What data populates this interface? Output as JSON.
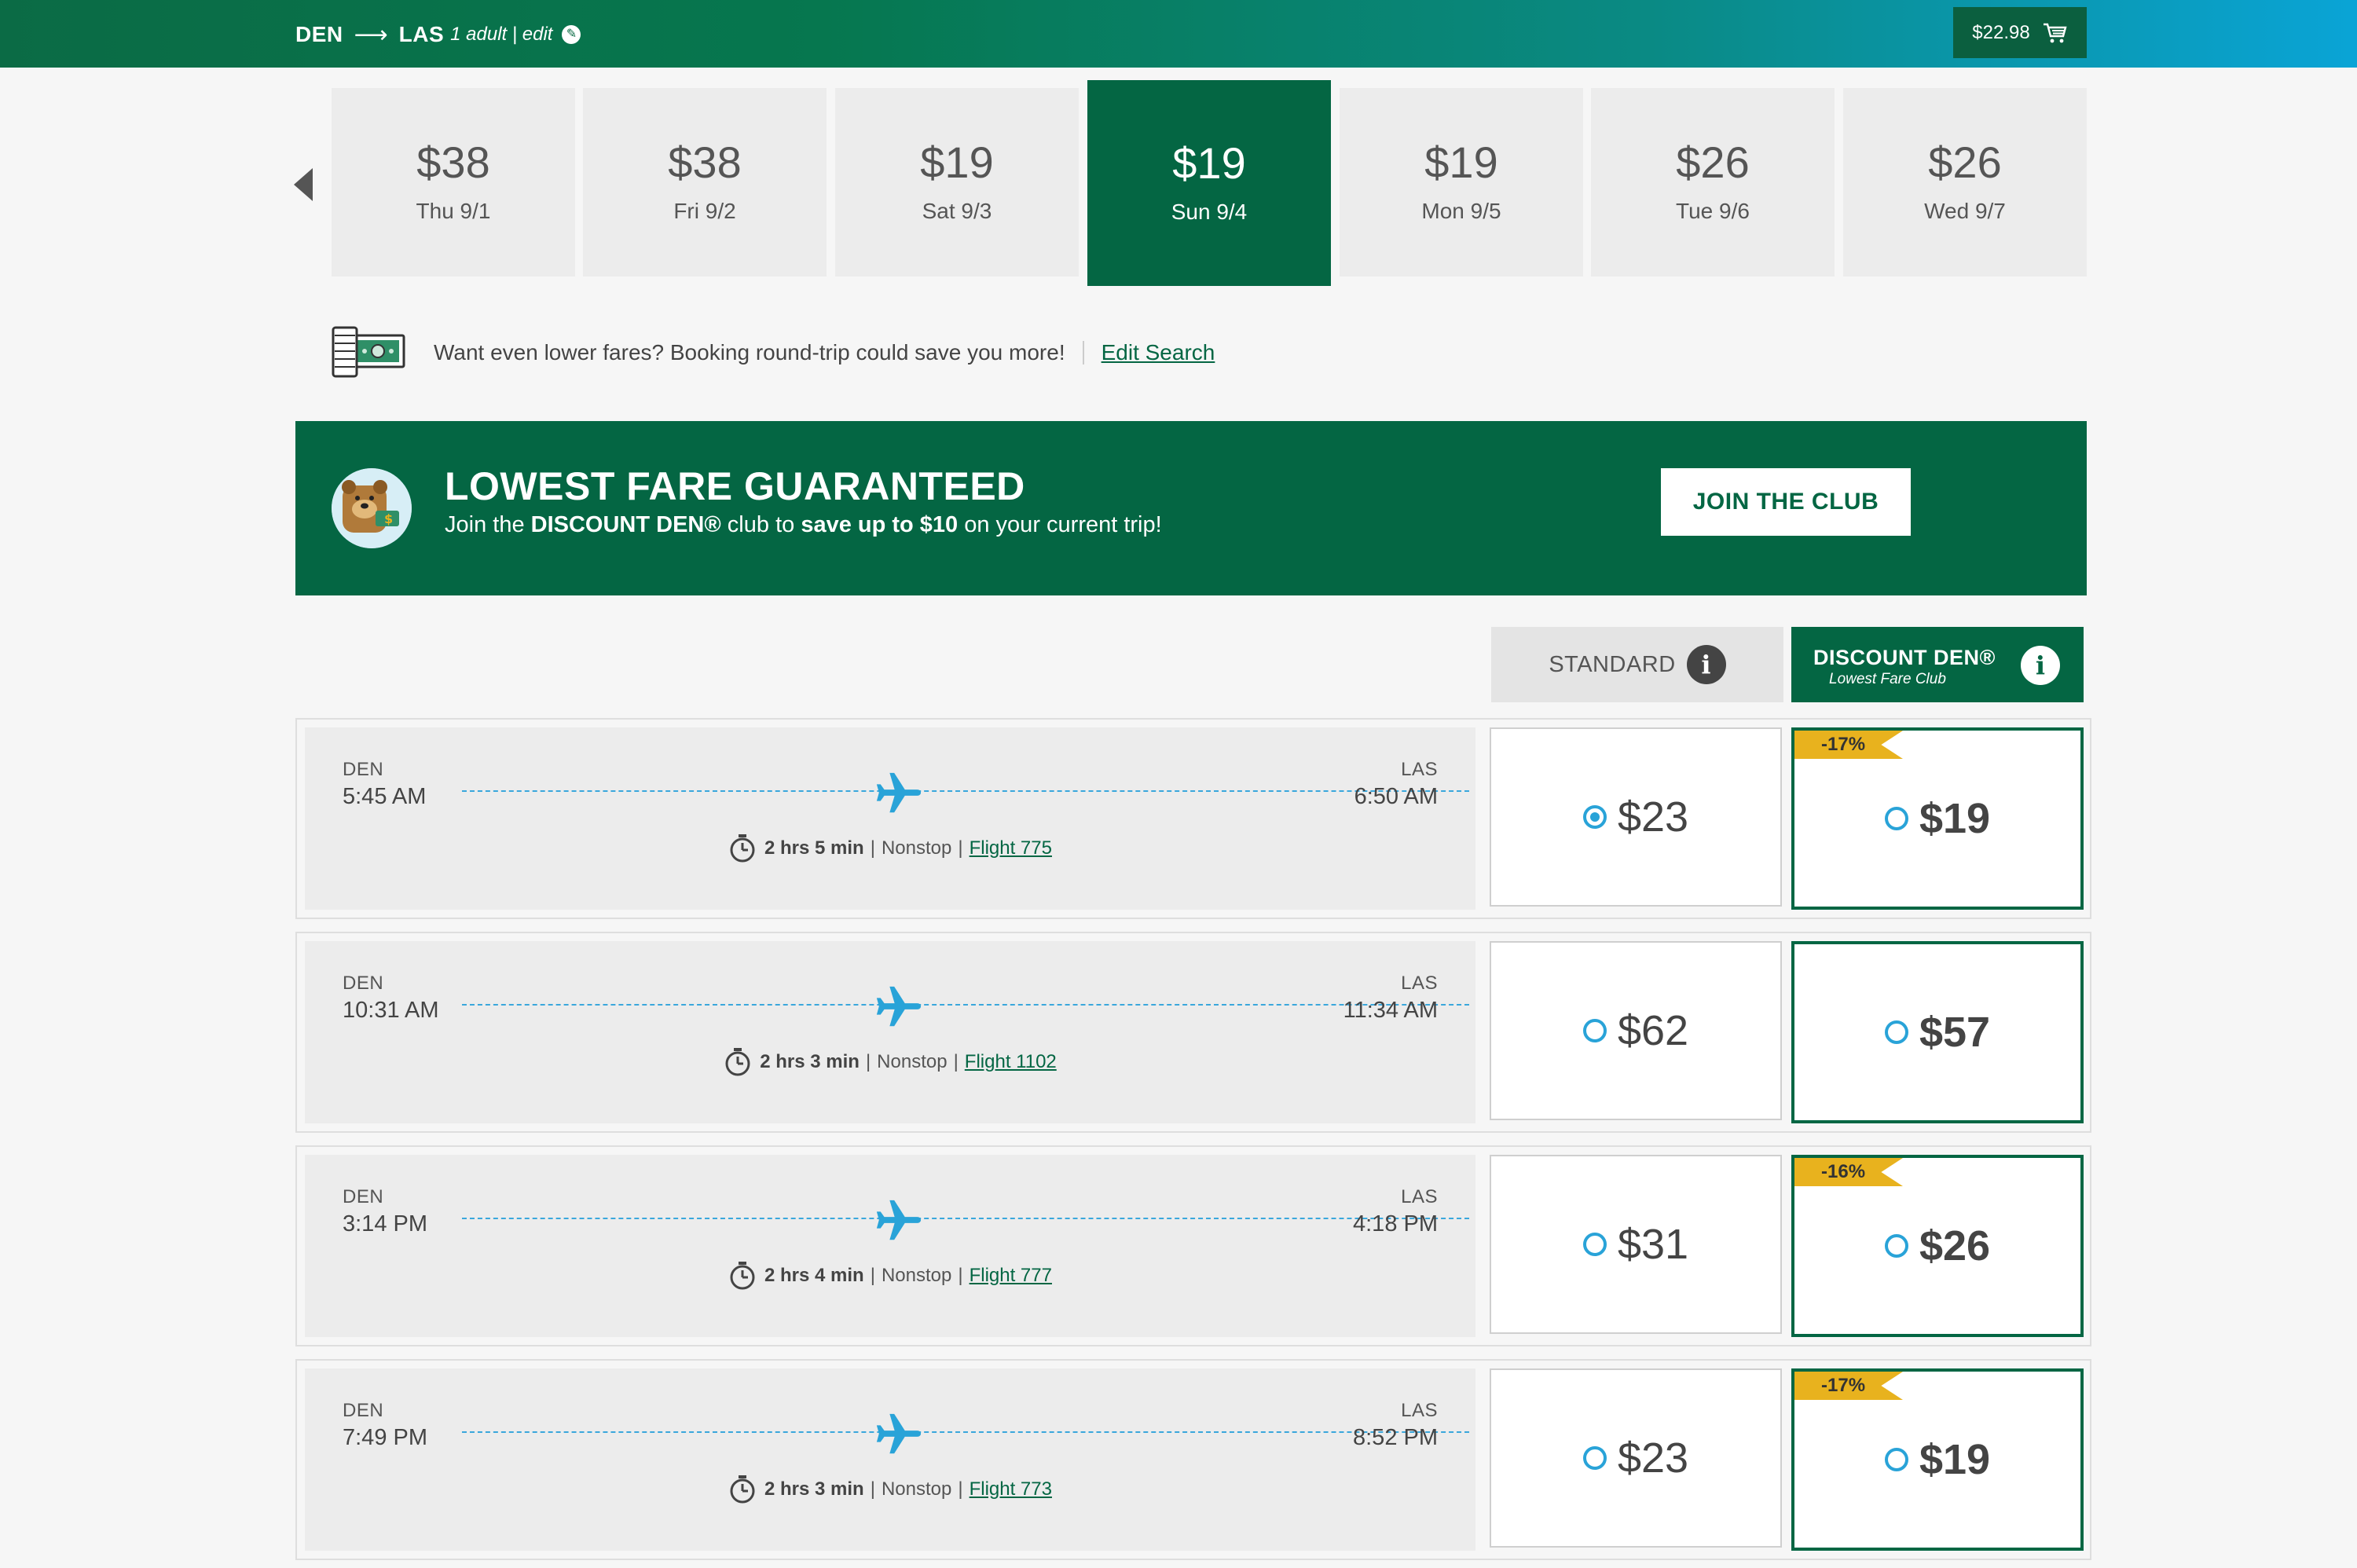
{
  "header": {
    "origin": "DEN",
    "destination": "LAS",
    "passengers": "1 adult | edit",
    "cart_total": "$22.98"
  },
  "dates": [
    {
      "price": "$38",
      "label": "Thu 9/1",
      "selected": false
    },
    {
      "price": "$38",
      "label": "Fri 9/2",
      "selected": false
    },
    {
      "price": "$19",
      "label": "Sat 9/3",
      "selected": false
    },
    {
      "price": "$19",
      "label": "Sun 9/4",
      "selected": true
    },
    {
      "price": "$19",
      "label": "Mon 9/5",
      "selected": false
    },
    {
      "price": "$26",
      "label": "Tue 9/6",
      "selected": false
    },
    {
      "price": "$26",
      "label": "Wed 9/7",
      "selected": false
    }
  ],
  "promo": {
    "text": "Want even lower fares? Booking round-trip could save you more!",
    "link": "Edit Search"
  },
  "banner": {
    "title": "LOWEST FARE GUARANTEED",
    "sub_1": "Join the ",
    "sub_brand": "DISCOUNT DEN®",
    "sub_2": " club to ",
    "sub_save": "save up to $10",
    "sub_3": " on your current trip!",
    "button": "JOIN THE CLUB"
  },
  "fare_headers": {
    "standard": "STANDARD",
    "discount_title": "DISCOUNT DEN®",
    "discount_sub": "Lowest Fare Club"
  },
  "flights": [
    {
      "from": "DEN",
      "depart": "5:45 AM",
      "to": "LAS",
      "arrive": "6:50 AM",
      "duration": "2 hrs 5 min",
      "stops": "Nonstop",
      "flight": "Flight 775",
      "standard": "$23",
      "discount": "$19",
      "badge": "-17%",
      "selected": true
    },
    {
      "from": "DEN",
      "depart": "10:31 AM",
      "to": "LAS",
      "arrive": "11:34 AM",
      "duration": "2 hrs 3 min",
      "stops": "Nonstop",
      "flight": "Flight 1102",
      "standard": "$62",
      "discount": "$57",
      "badge": "",
      "selected": false
    },
    {
      "from": "DEN",
      "depart": "3:14 PM",
      "to": "LAS",
      "arrive": "4:18 PM",
      "duration": "2 hrs 4 min",
      "stops": "Nonstop",
      "flight": "Flight 777",
      "standard": "$31",
      "discount": "$26",
      "badge": "-16%",
      "selected": false
    },
    {
      "from": "DEN",
      "depart": "7:49 PM",
      "to": "LAS",
      "arrive": "8:52 PM",
      "duration": "2 hrs 3 min",
      "stops": "Nonstop",
      "flight": "Flight 773",
      "standard": "$23",
      "discount": "$19",
      "badge": "-17%",
      "selected": false
    }
  ],
  "colors": {
    "brand_green": "#046643",
    "accent_blue": "#29a3d8",
    "badge_gold": "#e8b21e"
  }
}
